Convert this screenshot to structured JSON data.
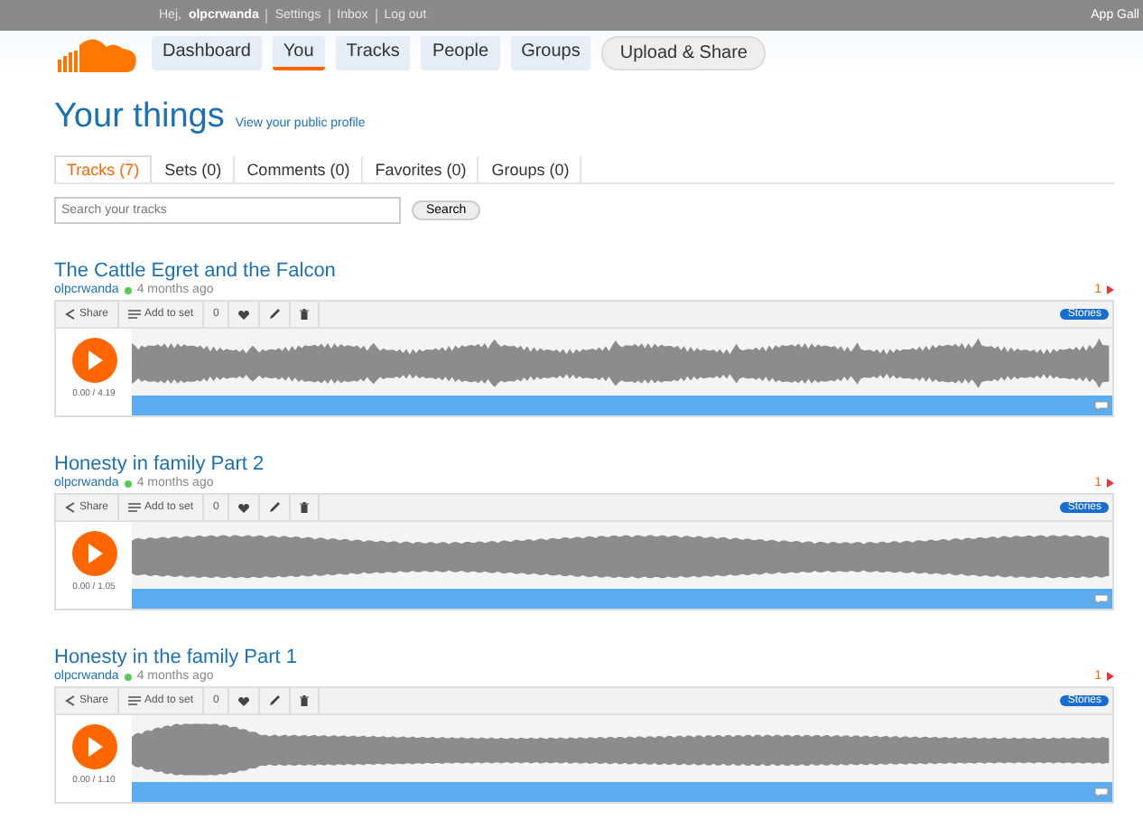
{
  "user_bar": {
    "greeting": "Hej,",
    "username": "olpcrwanda",
    "links": [
      "Settings",
      "Inbox",
      "Log out"
    ],
    "right_link": "App Gall"
  },
  "nav": [
    {
      "label": "Dashboard",
      "selected": false
    },
    {
      "label": "You",
      "selected": true
    },
    {
      "label": "Tracks",
      "selected": false
    },
    {
      "label": "People",
      "selected": false
    },
    {
      "label": "Groups",
      "selected": false
    }
  ],
  "upload_button": "Upload & Share",
  "page_title": "Your things",
  "profile_link": "View your public profile",
  "tabs": [
    {
      "label": "Tracks (7)",
      "selected": true
    },
    {
      "label": "Sets (0)",
      "selected": false
    },
    {
      "label": "Comments (0)",
      "selected": false
    },
    {
      "label": "Favorites (0)",
      "selected": false
    },
    {
      "label": "Groups (0)",
      "selected": false
    }
  ],
  "search": {
    "placeholder": "Search your tracks",
    "button": "Search"
  },
  "tracks": [
    {
      "title": "The Cattle Egret and the Falcon",
      "user": "olpcrwanda",
      "online": true,
      "age": "4 months ago",
      "comments": "1",
      "share": "Share",
      "add_to_set": "Add to set",
      "count": "0",
      "tag": "Stories",
      "time": "0.00 / 4.19"
    },
    {
      "title": "Honesty in family Part 2",
      "user": "olpcrwanda",
      "online": true,
      "age": "4 months ago",
      "comments": "1",
      "share": "Share",
      "add_to_set": "Add to set",
      "count": "0",
      "tag": "Stories",
      "time": "0.00 / 1.05"
    },
    {
      "title": "Honesty in the family Part 1",
      "user": "olpcrwanda",
      "online": true,
      "age": "4 months ago",
      "comments": "1",
      "share": "Share",
      "add_to_set": "Add to set",
      "count": "0",
      "tag": "Stories",
      "time": "0.00 / 1.10"
    }
  ]
}
